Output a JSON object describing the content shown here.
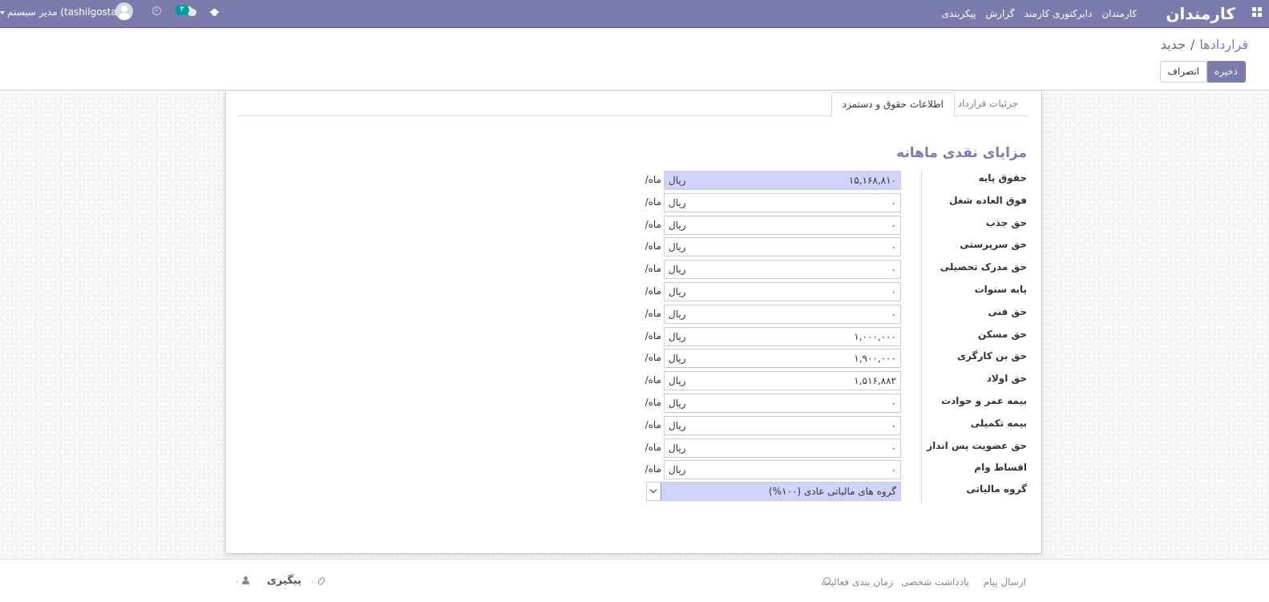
{
  "navbar": {
    "brand": "کارمندان",
    "menu": [
      "کارمندان",
      "دایرکتوری کارمند",
      "گزارش",
      "پیکربندی"
    ],
    "user": "مدیر سیستم (tashilgostar)",
    "chat_count": "۳",
    "bg_color": "#7c7bad"
  },
  "breadcrumb": {
    "parent": "قراردادها",
    "separator": "/",
    "current": "جدید"
  },
  "buttons": {
    "save": "ذخیره",
    "discard": "انصراف"
  },
  "tabs": [
    "جزئیات قرارداد",
    "اطلاعات حقوق و دستمزد"
  ],
  "section": {
    "title": "مزایای نقدی ماهانه"
  },
  "currency": "ریال",
  "period": "/ماه",
  "fields": [
    {
      "label": "حقوق پایه",
      "value": "۱۵,۱۶۸,۸۱۰",
      "highlight": true
    },
    {
      "label": "فوق العاده شغل",
      "value": "۰"
    },
    {
      "label": "حق جذب",
      "value": "۰"
    },
    {
      "label": "حق سرپرستی",
      "value": "۰"
    },
    {
      "label": "حق مدرک تحصیلی",
      "value": "۰"
    },
    {
      "label": "پایه سنوات",
      "value": "۰"
    },
    {
      "label": "حق فنی",
      "value": "۰"
    },
    {
      "label": "حق مسکن",
      "value": "۱,۰۰۰,۰۰۰"
    },
    {
      "label": "حق بن کارگری",
      "value": "۱,۹۰۰,۰۰۰"
    },
    {
      "label": "حق اولاد",
      "value": "۱,۵۱۶,۸۸۲"
    },
    {
      "label": "بیمه عمر و حوادث",
      "value": "۰"
    },
    {
      "label": "بیمه تکمیلی",
      "value": "۰"
    },
    {
      "label": "حق عضویت پس انداز",
      "value": "۰"
    },
    {
      "label": "اقساط وام",
      "value": "۰"
    }
  ],
  "tax_group": {
    "label": "گروه مالیاتی",
    "value": "گروه های مالیاتی عادی (۱۰۰%)"
  },
  "chatter": {
    "send_message": "ارسال پیام",
    "log_note": "یادداشت شخصی",
    "schedule_activity": "زمان بندی فعالیت",
    "follow": "پیگیری",
    "attachments_count": "۰",
    "followers_count": "۰"
  }
}
